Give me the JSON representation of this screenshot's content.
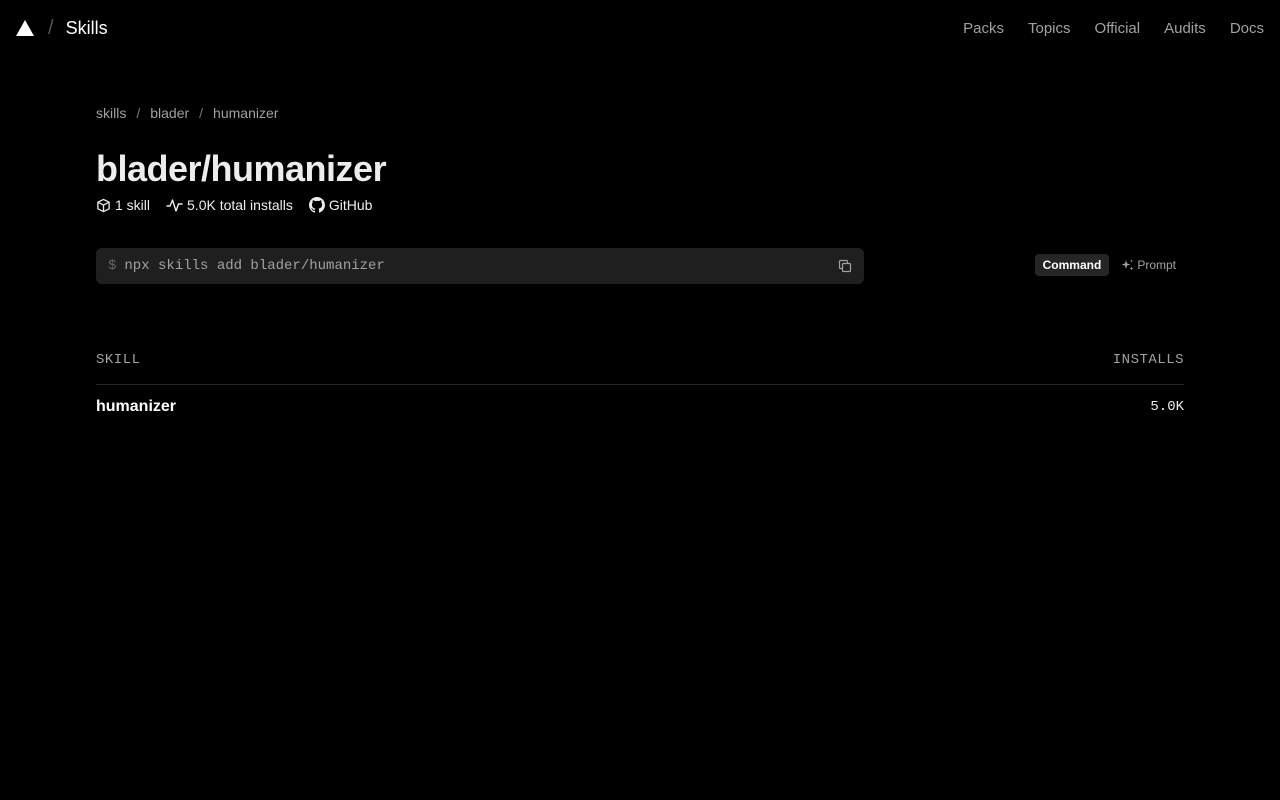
{
  "header": {
    "brand": "Skills",
    "nav": [
      "Packs",
      "Topics",
      "Official",
      "Audits",
      "Docs"
    ]
  },
  "breadcrumb": [
    "skills",
    "blader",
    "humanizer"
  ],
  "page": {
    "title": "blader/humanizer",
    "skill_count": "1 skill",
    "total_installs": "5.0K total installs",
    "github_label": "GitHub"
  },
  "command": {
    "prompt": "$",
    "text": "npx skills add blader/humanizer",
    "copy_icon": "copy-icon"
  },
  "mode_toggle": {
    "options": [
      "Command",
      "Prompt"
    ],
    "selected": "Command"
  },
  "table": {
    "columns": [
      "SKILL",
      "INSTALLS"
    ],
    "rows": [
      {
        "name": "humanizer",
        "installs": "5.0K"
      }
    ]
  }
}
